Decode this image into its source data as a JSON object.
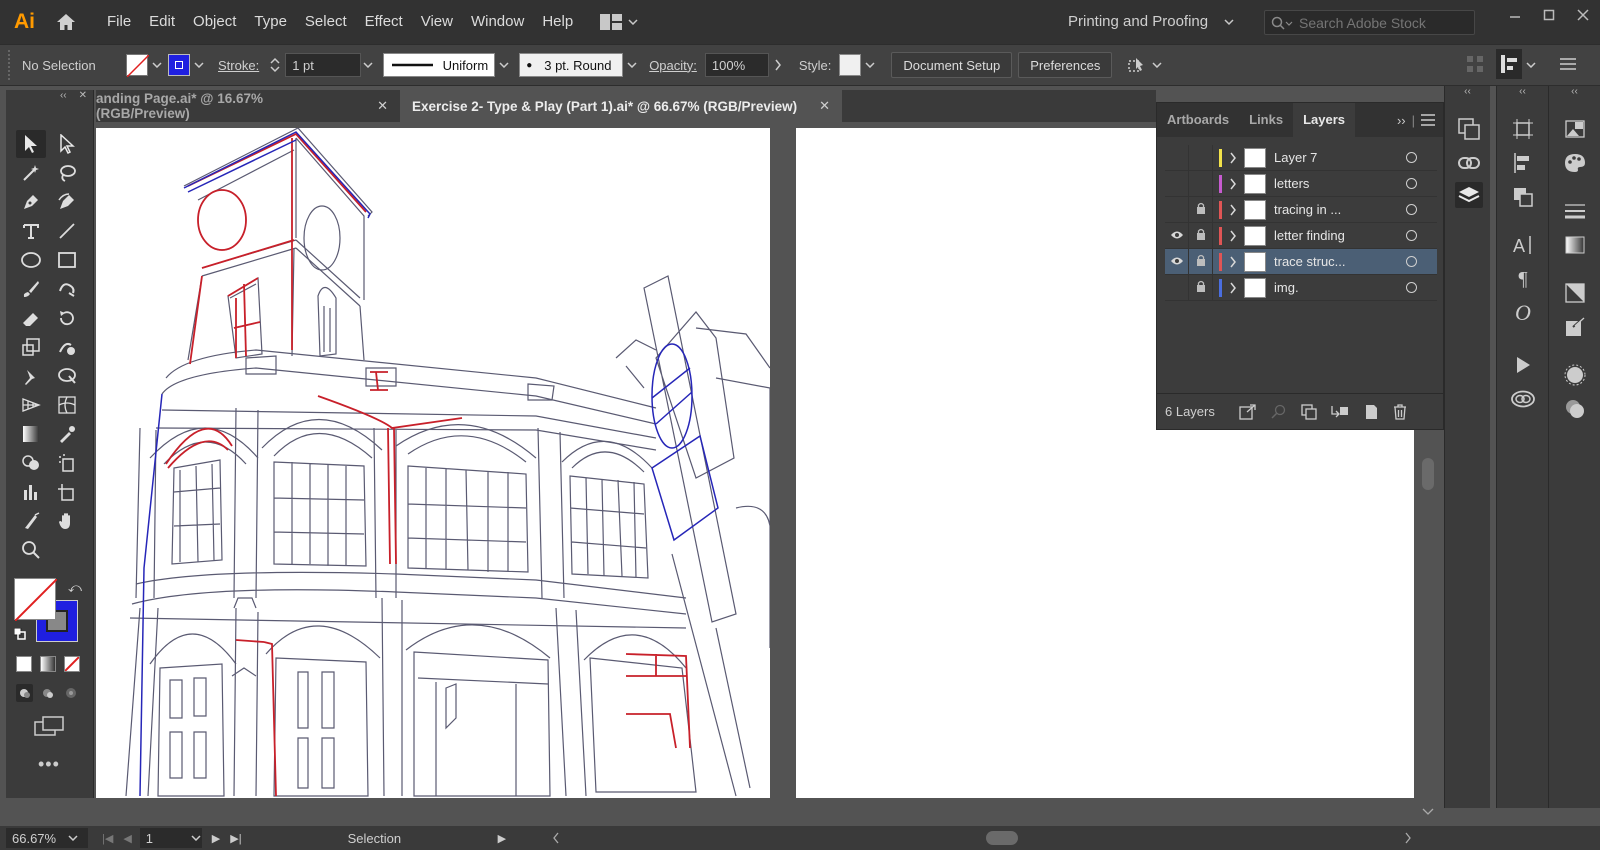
{
  "app": {
    "logo": "Ai",
    "menu": [
      "File",
      "Edit",
      "Object",
      "Type",
      "Select",
      "Effect",
      "View",
      "Window",
      "Help"
    ],
    "workspace": "Printing and Proofing",
    "search_placeholder": "Search Adobe Stock"
  },
  "controlbar": {
    "selection": "No Selection",
    "stroke_label": "Stroke:",
    "stroke_weight": "1 pt",
    "stroke_profile": "Uniform",
    "brush": "3 pt. Round",
    "opacity_label": "Opacity:",
    "opacity": "100%",
    "style_label": "Style:",
    "document_setup": "Document Setup",
    "preferences": "Preferences"
  },
  "tabs": [
    {
      "label": "anding Page.ai* @ 16.67% (RGB/Preview)",
      "active": false
    },
    {
      "label": "Exercise 2- Type & Play (Part 1).ai* @ 66.67% (RGB/Preview)",
      "active": true
    }
  ],
  "layers_panel": {
    "tabs": [
      "Artboards",
      "Links",
      "Layers"
    ],
    "active_tab": "Layers",
    "layers": [
      {
        "name": "Layer 7",
        "color": "#f2e24a",
        "visible": false,
        "locked": false,
        "selected": false
      },
      {
        "name": "letters",
        "color": "#c75bd0",
        "visible": false,
        "locked": false,
        "selected": false
      },
      {
        "name": "tracing in ...",
        "color": "#e05555",
        "visible": false,
        "locked": true,
        "selected": false
      },
      {
        "name": "letter finding",
        "color": "#e05555",
        "visible": true,
        "locked": true,
        "selected": false
      },
      {
        "name": "trace struc...",
        "color": "#e05555",
        "visible": true,
        "locked": true,
        "selected": true
      },
      {
        "name": "img.",
        "color": "#4a6ee0",
        "visible": false,
        "locked": true,
        "selected": false
      }
    ],
    "count": "6 Layers"
  },
  "status": {
    "zoom": "66.67%",
    "page": "1",
    "tool": "Selection"
  },
  "colors": {
    "accent_fill_stroke": "#1f1fe0",
    "trace_red": "#c8202a",
    "trace_blue": "#2626b8",
    "trace_gray": "#5a5a72"
  }
}
